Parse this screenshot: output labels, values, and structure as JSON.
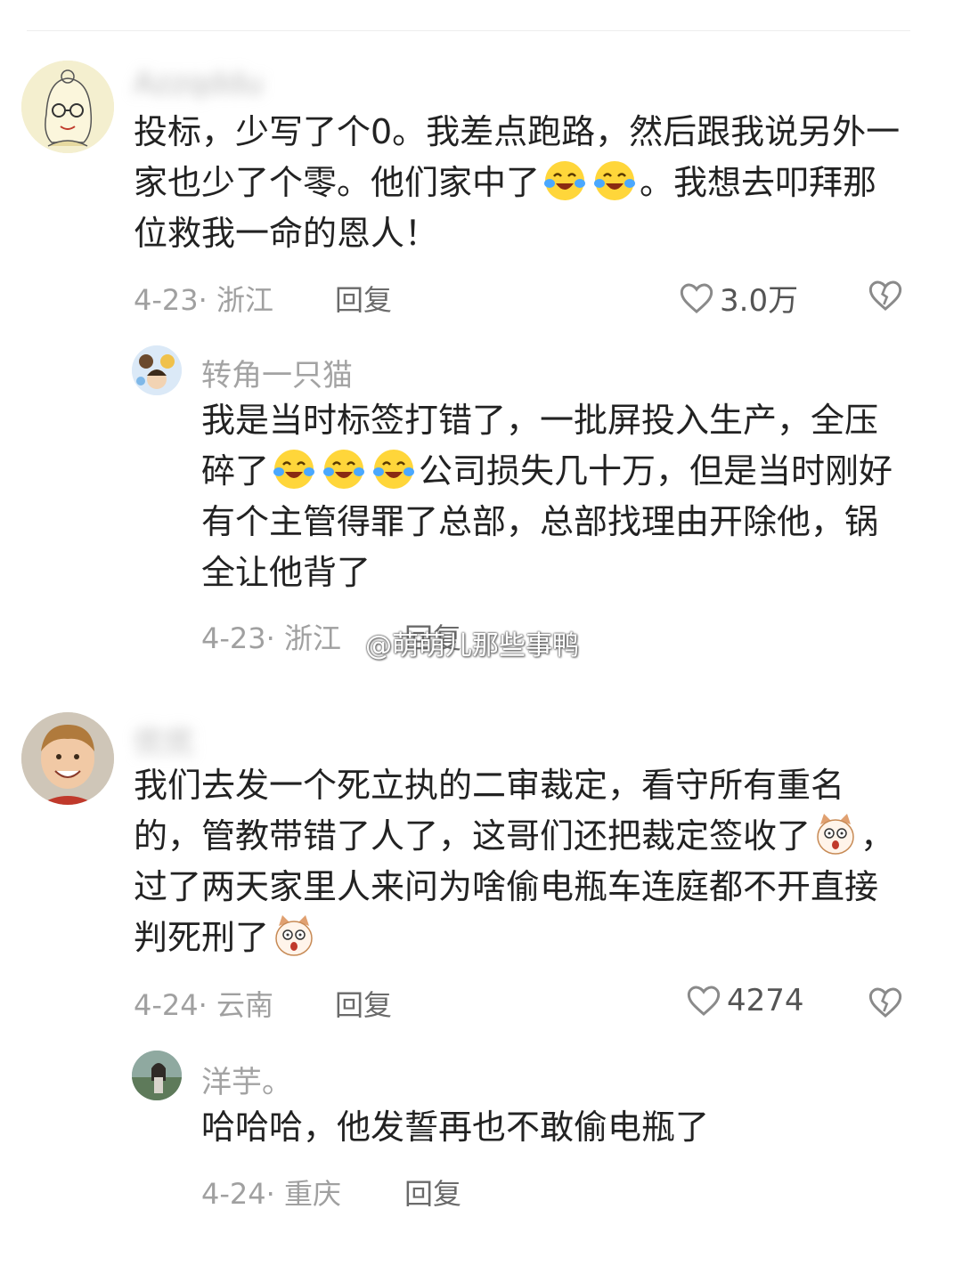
{
  "comments": [
    {
      "username": "Azzqddu",
      "text_parts": [
        "投标，少写了个0。我差点跑路，然后跟我说另外一家也少了个零。他们家中了",
        "。我想去叩拜那位救我一命的恩人！"
      ],
      "emoji": "laughing-crying-emoji",
      "meta": "4-23· 浙江",
      "reply_label": "回复",
      "likes": "3.0万",
      "reply": {
        "username": "转角一只猫",
        "text_parts": [
          "我是当时标签打错了，一批屏投入生产，全压碎了",
          "公司损失几十万，但是当时刚好有个主管得罪了总部，总部找理由开除他，锅全让他背了"
        ],
        "meta": "4-23· 浙江",
        "reply_label": "回复"
      }
    },
    {
      "username": "优优",
      "text_parts": [
        "我们去发一个死立执的二审裁定，看守所有重名的，管教带错了人了，这哥们还把裁定签收了",
        "，过了两天家里人来问为啥偷电瓶车连庭都不开直接判死刑了"
      ],
      "emoji": "shocked-cat-emoji",
      "meta": "4-24· 云南",
      "reply_label": "回复",
      "likes": "4274",
      "reply": {
        "username": "洋芋。",
        "text": "哈哈哈，他发誓再也不敢偷电瓶了",
        "meta": "4-24· 重庆",
        "reply_label": "回复"
      }
    }
  ],
  "watermark": "@萌萌儿那些事鸭",
  "colors": {
    "text": "#222222",
    "meta": "#a0a0a0",
    "reply": "#6a6a6a",
    "icon": "#bdbdbd"
  },
  "icons": {
    "like": "heart-outline-icon",
    "dislike": "broken-heart-icon"
  }
}
